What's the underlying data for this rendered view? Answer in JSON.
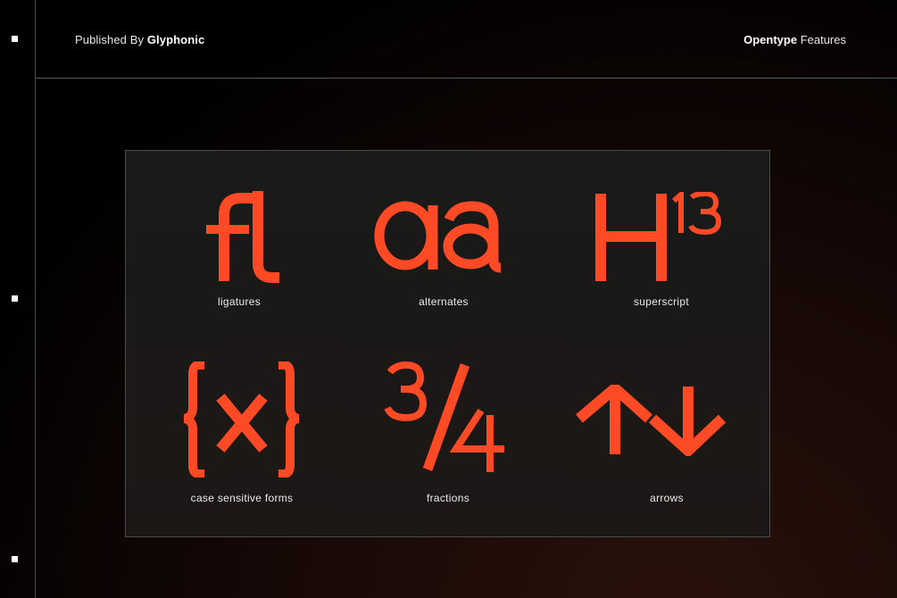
{
  "header": {
    "published_prefix": "Published By",
    "publisher": "Glyphonic",
    "features_bold": "Opentype",
    "features_rest": "Features"
  },
  "accent_color": "#ff4a26",
  "features": [
    {
      "glyph": "fl",
      "label": "ligatures"
    },
    {
      "glyph": "aa",
      "label": "alternates"
    },
    {
      "glyph": "H",
      "sup": "13",
      "label": "superscript"
    },
    {
      "glyph": "{x}",
      "label": "case sensitive forms"
    },
    {
      "glyph": "3/4",
      "label": "fractions"
    },
    {
      "glyph": "arrows",
      "label": "arrows"
    }
  ]
}
